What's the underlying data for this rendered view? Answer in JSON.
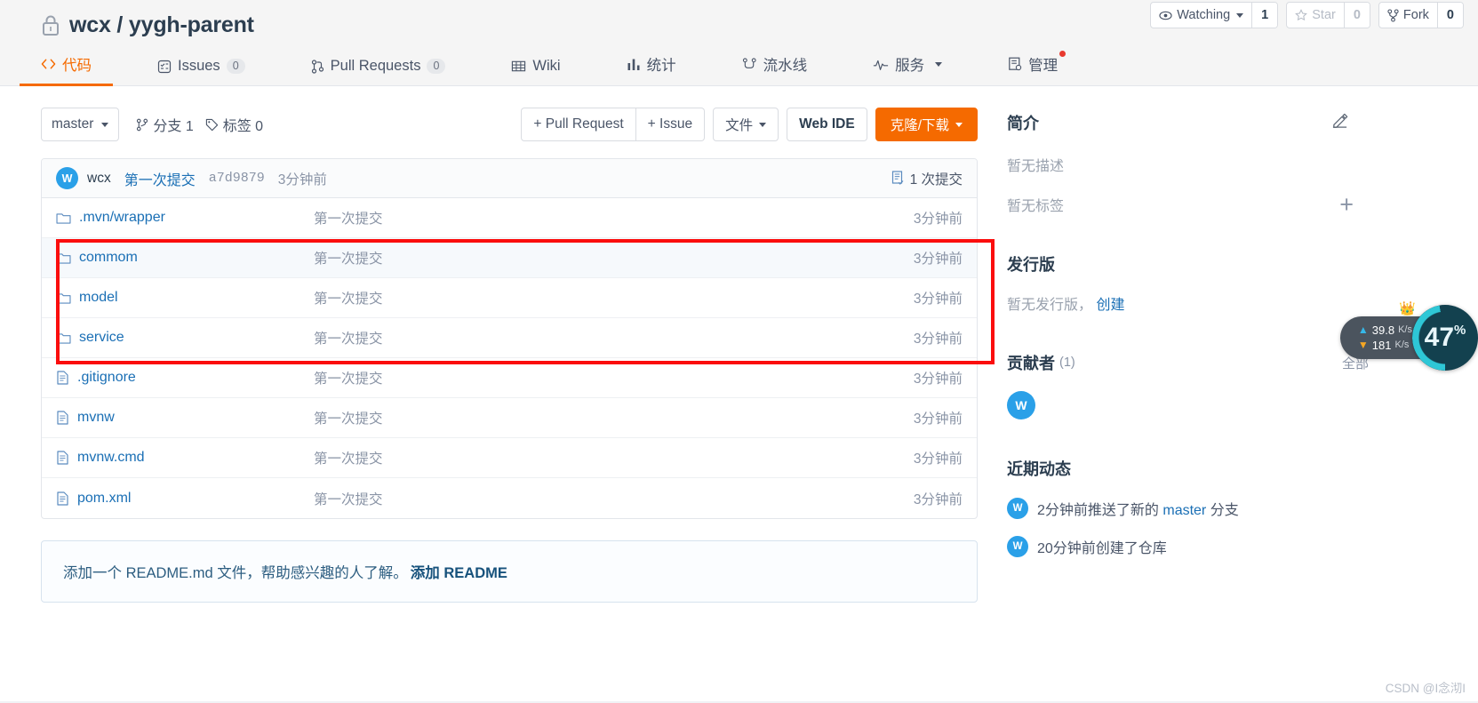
{
  "header": {
    "owner": "wcx",
    "separator": "/",
    "repo": "yygh-parent",
    "lock_icon": "lock-icon",
    "actions": [
      {
        "icon": "eye-icon",
        "label": "Watching",
        "count": "1",
        "has_caret": true,
        "dim": false
      },
      {
        "icon": "star-icon",
        "label": "Star",
        "count": "0",
        "has_caret": false,
        "dim": true
      },
      {
        "icon": "fork-icon",
        "label": "Fork",
        "count": "0",
        "has_caret": false,
        "dim": false
      }
    ]
  },
  "tabs": [
    {
      "icon": "code-icon",
      "label": "代码",
      "count": "",
      "active": true,
      "caret": false,
      "dot": false
    },
    {
      "icon": "issues-icon",
      "label": "Issues",
      "count": "0",
      "active": false,
      "caret": false,
      "dot": false
    },
    {
      "icon": "pull-request-icon",
      "label": "Pull Requests",
      "count": "0",
      "active": false,
      "caret": false,
      "dot": false
    },
    {
      "icon": "wiki-icon",
      "label": "Wiki",
      "count": "",
      "active": false,
      "caret": false,
      "dot": false
    },
    {
      "icon": "stats-icon",
      "label": "统计",
      "count": "",
      "active": false,
      "caret": false,
      "dot": false
    },
    {
      "icon": "pipeline-icon",
      "label": "流水线",
      "count": "",
      "active": false,
      "caret": false,
      "dot": false
    },
    {
      "icon": "service-icon",
      "label": "服务",
      "count": "",
      "active": false,
      "caret": true,
      "dot": false
    },
    {
      "icon": "manage-icon",
      "label": "管理",
      "count": "",
      "active": false,
      "caret": false,
      "dot": true
    }
  ],
  "toolbar": {
    "branch_label": "master",
    "branches_icon": "branch-icon",
    "branches_label": "分支 1",
    "tags_icon": "tag-icon",
    "tags_label": "标签 0",
    "pull_request_label": "+ Pull Request",
    "issue_label": "+ Issue",
    "files_label": "文件",
    "web_ide_label": "Web IDE",
    "clone_label": "克隆/下载",
    "accent_color": "#f56a00"
  },
  "commit_bar": {
    "avatar_initial": "W",
    "author": "wcx",
    "message": "第一次提交",
    "sha": "a7d9879",
    "time": "3分钟前",
    "count_icon": "commits-icon",
    "count_label": "1 次提交"
  },
  "files": [
    {
      "icon": "folder-icon",
      "name": ".mvn/wrapper",
      "commit": "第一次提交",
      "time": "3分钟前",
      "highlight": false
    },
    {
      "icon": "folder-icon",
      "name": "commom",
      "commit": "第一次提交",
      "time": "3分钟前",
      "highlight": true
    },
    {
      "icon": "folder-icon",
      "name": "model",
      "commit": "第一次提交",
      "time": "3分钟前",
      "highlight": false
    },
    {
      "icon": "folder-icon",
      "name": "service",
      "commit": "第一次提交",
      "time": "3分钟前",
      "highlight": false
    },
    {
      "icon": "file-icon",
      "name": ".gitignore",
      "commit": "第一次提交",
      "time": "3分钟前",
      "highlight": false
    },
    {
      "icon": "file-icon",
      "name": "mvnw",
      "commit": "第一次提交",
      "time": "3分钟前",
      "highlight": false
    },
    {
      "icon": "file-icon",
      "name": "mvnw.cmd",
      "commit": "第一次提交",
      "time": "3分钟前",
      "highlight": false
    },
    {
      "icon": "file-icon",
      "name": "pom.xml",
      "commit": "第一次提交",
      "time": "3分钟前",
      "highlight": false
    }
  ],
  "readme": {
    "text": "添加一个 README.md 文件，帮助感兴趣的人了解。",
    "link": "添加 README"
  },
  "sidebar": {
    "intro_title": "简介",
    "edit_icon": "edit-icon",
    "no_description": "暂无描述",
    "no_tags": "暂无标签",
    "add_icon": "plus-icon",
    "release_title": "发行版",
    "no_release": "暂无发行版，",
    "create_link": "创建",
    "contributors_title": "贡献者",
    "contributors_count": "(1)",
    "contributors_all": "全部",
    "contributor_avatar": "W",
    "activity_title": "近期动态",
    "activities": [
      {
        "avatar": "W",
        "prefix": "2分钟前推送了新的 ",
        "link": "master",
        "suffix": " 分支"
      },
      {
        "avatar": "W",
        "prefix": "20分钟前创建了仓库",
        "link": "",
        "suffix": ""
      }
    ]
  },
  "speed_widget": {
    "vip_badge": "VIP",
    "upload_value": "39.8",
    "upload_unit": "K/s",
    "download_value": "181",
    "download_unit": "K/s",
    "percent": "47",
    "percent_sign": "%"
  },
  "watermark": "CSDN @I念沏I"
}
